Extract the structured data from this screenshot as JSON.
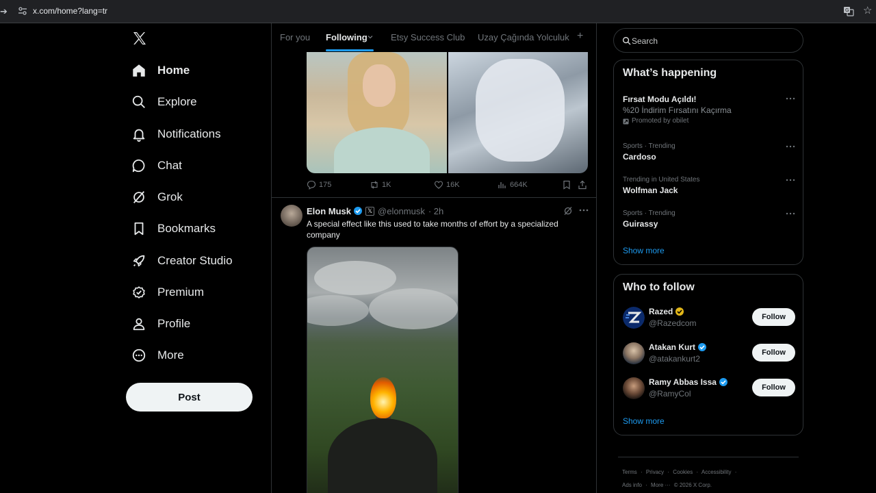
{
  "browser": {
    "url": "x.com/home?lang=tr"
  },
  "nav": {
    "items": [
      {
        "label": "Home",
        "icon": "home-icon"
      },
      {
        "label": "Explore",
        "icon": "search-icon"
      },
      {
        "label": "Notifications",
        "icon": "bell-icon"
      },
      {
        "label": "Chat",
        "icon": "chat-icon"
      },
      {
        "label": "Grok",
        "icon": "grok-icon"
      },
      {
        "label": "Bookmarks",
        "icon": "bookmark-icon"
      },
      {
        "label": "Creator Studio",
        "icon": "rocket-icon"
      },
      {
        "label": "Premium",
        "icon": "premium-icon"
      },
      {
        "label": "Profile",
        "icon": "person-icon"
      },
      {
        "label": "More",
        "icon": "more-circle-icon"
      }
    ],
    "post_label": "Post"
  },
  "tabs": {
    "items": [
      "For you",
      "Following",
      "Etsy Success Club",
      "Uzay Çağında Yolculuk"
    ],
    "active": "Following",
    "add": "+"
  },
  "prev_tweet": {
    "replies": "175",
    "reposts": "1K",
    "likes": "16K",
    "views": "664K"
  },
  "tweet": {
    "name": "Elon Musk",
    "handle": "@elonmusk",
    "time": "· 2h",
    "text": "A special effect like this used to take months of effort by a specialized company"
  },
  "search": {
    "placeholder": "Search"
  },
  "happening": {
    "title": "What’s happening",
    "promo": {
      "name": "Fırsat Modu Açıldı!",
      "desc": "%20 İndirim Fırsatını Kaçırma",
      "promoted": "Promoted by obilet"
    },
    "trends": [
      {
        "meta": "Sports · Trending",
        "name": "Cardoso"
      },
      {
        "meta": "Trending in United States",
        "name": "Wolfman Jack"
      },
      {
        "meta": "Sports · Trending",
        "name": "Guirassy"
      }
    ],
    "show_more": "Show more"
  },
  "who_to_follow": {
    "title": "Who to follow",
    "users": [
      {
        "name": "Razed",
        "handle": "@Razedcom",
        "badge": "gold"
      },
      {
        "name": "Atakan Kurt",
        "handle": "@atakankurt2",
        "badge": "blue"
      },
      {
        "name": "Ramy Abbas Issa",
        "handle": "@RamyCol",
        "badge": "blue"
      }
    ],
    "follow_label": "Follow",
    "show_more": "Show more"
  },
  "footer": {
    "line1": [
      "Terms",
      "·",
      "Privacy",
      "·",
      "Cookies",
      "·",
      "Accessibility",
      "·"
    ],
    "line2": [
      "Ads info",
      "·",
      "More ···",
      "© 2026 X Corp."
    ]
  },
  "colors": {
    "accent": "#1d9bf0",
    "background": "#000000",
    "border": "#2f3336",
    "verified_gold": "#e2b719"
  }
}
